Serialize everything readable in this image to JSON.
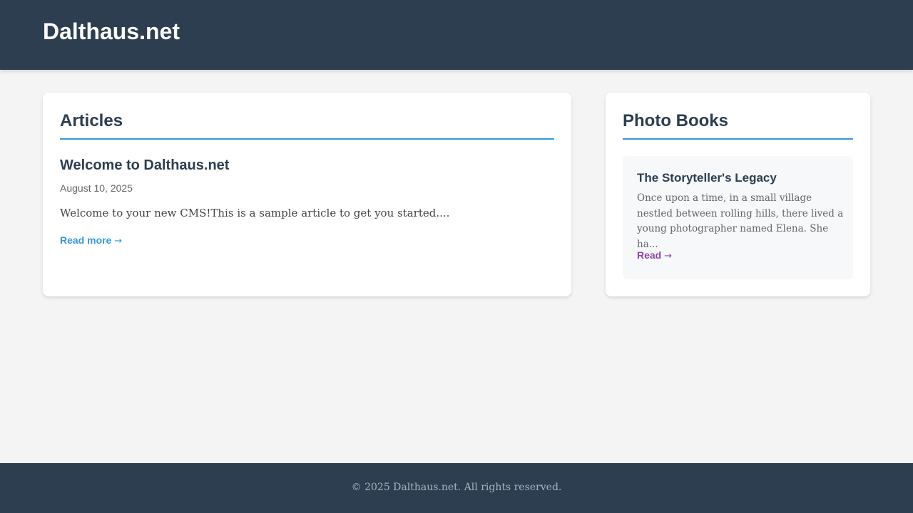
{
  "header": {
    "site_title": "Dalthaus.net"
  },
  "articles": {
    "heading": "Articles",
    "items": [
      {
        "title": "Welcome to Dalthaus.net",
        "date": "August 10, 2025",
        "excerpt": "Welcome to your new CMS!This is a sample article to get you started....",
        "link_label": "Read more",
        "link_arrow": "→"
      }
    ]
  },
  "photo_books": {
    "heading": "Photo Books",
    "items": [
      {
        "title": "The Storyteller's Legacy",
        "excerpt": "Once upon a time, in a small village nestled between rolling hills, there lived a young photographer named Elena. She ha...",
        "link_label": "Read",
        "link_arrow": "→"
      }
    ]
  },
  "footer": {
    "text": "© 2025 Dalthaus.net. All rights reserved."
  },
  "colors": {
    "header_bg": "#2c3e50",
    "accent_blue": "#3498db",
    "accent_purple": "#8e44ad",
    "page_bg": "#f4f4f4"
  }
}
